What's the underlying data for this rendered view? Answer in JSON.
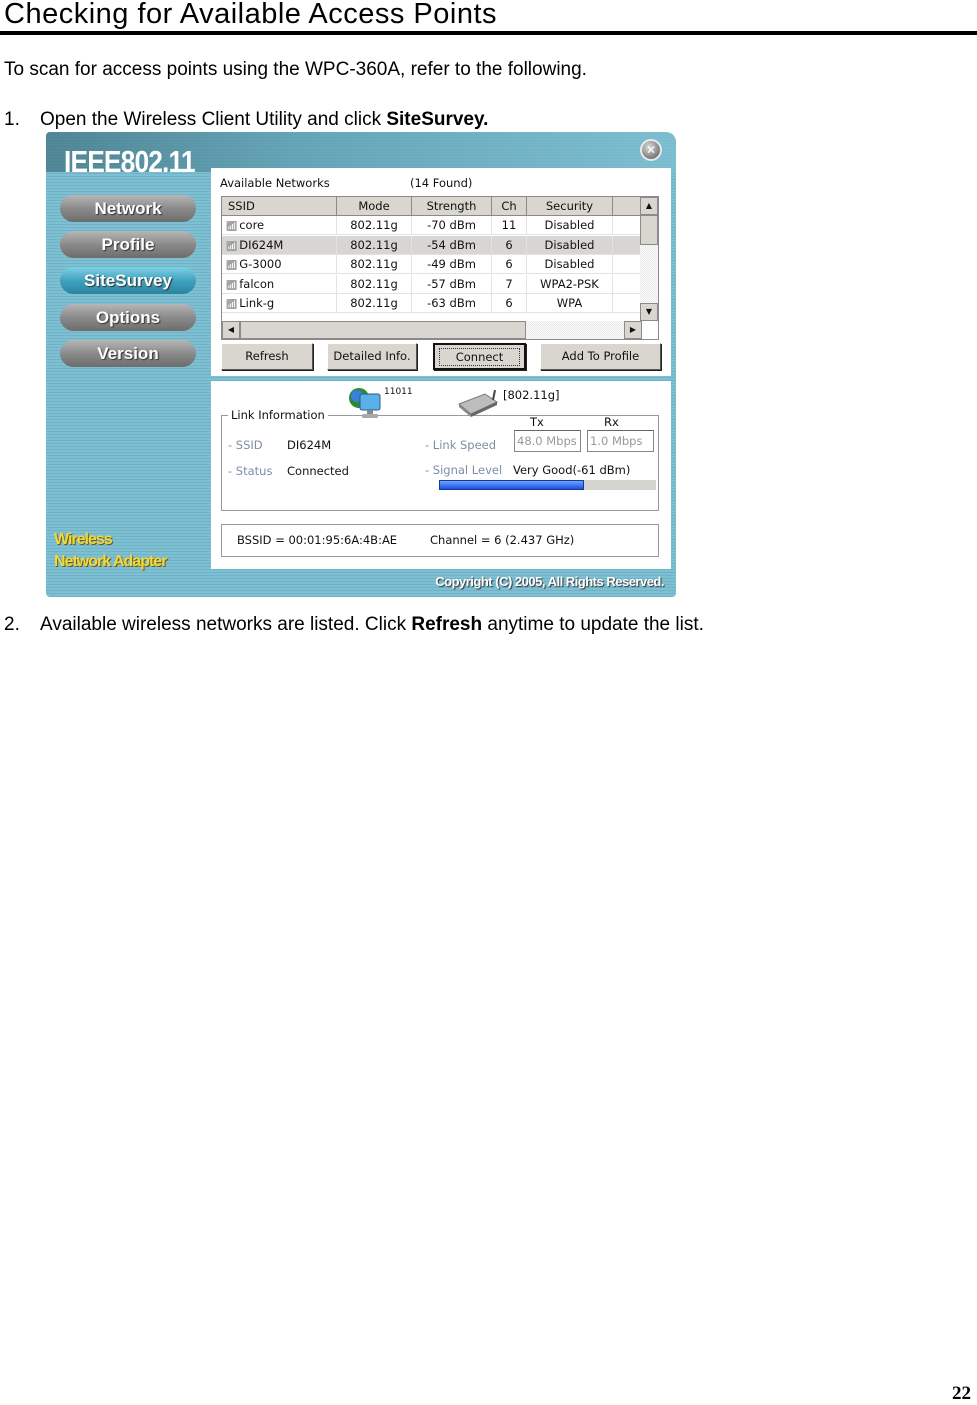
{
  "document": {
    "heading": "Checking for Available Access Points",
    "intro": "To scan for access points using the WPC-360A, refer to the following.",
    "steps": [
      {
        "num": "1.",
        "text_before": "Open the Wireless Client Utility and click ",
        "bold": "SiteSurvey.",
        "text_after": ""
      },
      {
        "num": "2.",
        "text_before": "Available wireless networks are listed. Click ",
        "bold": "Refresh",
        "text_after": " anytime to update the list."
      }
    ],
    "page_number": "22"
  },
  "app": {
    "logo": "IEEE802.11",
    "close_icon": "close-icon",
    "nav": [
      {
        "label": "Network",
        "active": false
      },
      {
        "label": "Profile",
        "active": false
      },
      {
        "label": "SiteSurvey",
        "active": true
      },
      {
        "label": "Options",
        "active": false
      },
      {
        "label": "Version",
        "active": false
      }
    ],
    "brand_line1": "Wireless",
    "brand_line2": "Network Adapter",
    "copyright": "Copyright (C) 2005, All Rights Reserved.",
    "networks": {
      "label": "Available Networks",
      "count": "(14 Found)",
      "columns": [
        "SSID",
        "Mode",
        "Strength",
        "Ch",
        "Security"
      ],
      "rows": [
        {
          "ssid": "core",
          "mode": "802.11g",
          "strength": "-70 dBm",
          "ch": "11",
          "security": "Disabled",
          "selected": false
        },
        {
          "ssid": "DI624M",
          "mode": "802.11g",
          "strength": "-54 dBm",
          "ch": "6",
          "security": "Disabled",
          "selected": true
        },
        {
          "ssid": "G-3000",
          "mode": "802.11g",
          "strength": "-49 dBm",
          "ch": "6",
          "security": "Disabled",
          "selected": false
        },
        {
          "ssid": "falcon",
          "mode": "802.11g",
          "strength": "-57 dBm",
          "ch": "7",
          "security": "WPA2-PSK",
          "selected": false
        },
        {
          "ssid": "Link-g",
          "mode": "802.11g",
          "strength": "-63 dBm",
          "ch": "6",
          "security": "WPA",
          "selected": false
        }
      ]
    },
    "buttons": {
      "refresh": "Refresh",
      "detailed_info": "Detailed Info.",
      "connect": "Connect",
      "add_to_profile": "Add To Profile"
    },
    "link_info": {
      "legend": "Link Information",
      "pc_code": "11011",
      "mode": "[802.11g]",
      "ssid_label": "- SSID",
      "ssid_value": "DI624M",
      "status_label": "- Status",
      "status_value": "Connected",
      "link_speed_label": "- Link Speed",
      "tx_label": "Tx",
      "rx_label": "Rx",
      "tx_value": "48.0 Mbps",
      "rx_value": "1.0 Mbps",
      "signal_label": "- Signal Level",
      "signal_value": "Very Good(-61 dBm)",
      "signal_fraction": 0.67
    },
    "bssid": "BSSID = 00:01:95:6A:4B:AE",
    "channel": "Channel = 6 (2.437 GHz)"
  }
}
